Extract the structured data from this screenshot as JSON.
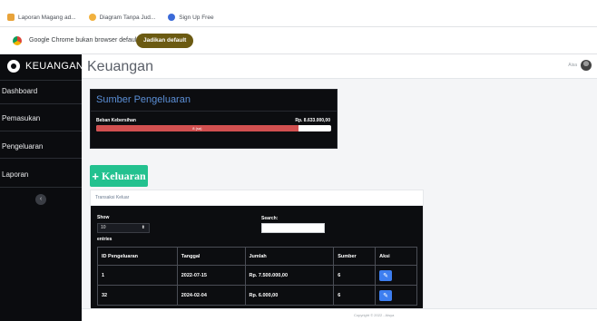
{
  "browser": {
    "bookmarks": [
      {
        "label": "Laporan Magang ad...",
        "color": "#e8a33a"
      },
      {
        "label": "Diagram Tanpa Jud...",
        "color": "#f1b13e"
      },
      {
        "label": "Sign Up Free",
        "color": "#3b6ad8"
      }
    ],
    "infobar": {
      "message": "Google Chrome bukan browser default",
      "button": "Jadikan default"
    }
  },
  "sidebar": {
    "brand": "KEUANGAN",
    "items": [
      {
        "label": "Dashboard"
      },
      {
        "label": "Pemasukan"
      },
      {
        "label": "Pengeluaran"
      },
      {
        "label": "Laporan"
      }
    ],
    "toggle_icon": "‹"
  },
  "header": {
    "title": "Keuangan",
    "user_name": "Aisa"
  },
  "summary_card": {
    "title": "Sumber Pengeluaran",
    "label": "Beban Kebersihan",
    "value": "Rp. 8.633.000,00",
    "progress_percent": 86,
    "progress_label": "8 (sa)"
  },
  "keluaran_button": {
    "icon": "+",
    "label": "Keluaran"
  },
  "transactions": {
    "header": "Transaksi Keluar",
    "show_label": "Show",
    "entries_value": "10",
    "entries_label": "entries",
    "search_label": "Search:",
    "columns": [
      "ID Pengeluaran",
      "Tanggal",
      "Jumlah",
      "Sumber",
      "Aksi"
    ],
    "rows": [
      {
        "id": "1",
        "tanggal": "2022-07-15",
        "jumlah": "Rp. 7.500.000,00",
        "sumber": "6"
      },
      {
        "id": "32",
        "tanggal": "2024-02-04",
        "jumlah": "Rp. 6.000,00",
        "sumber": "6"
      }
    ]
  },
  "footer": {
    "text": "Copyright © 2022 - Aisya"
  }
}
